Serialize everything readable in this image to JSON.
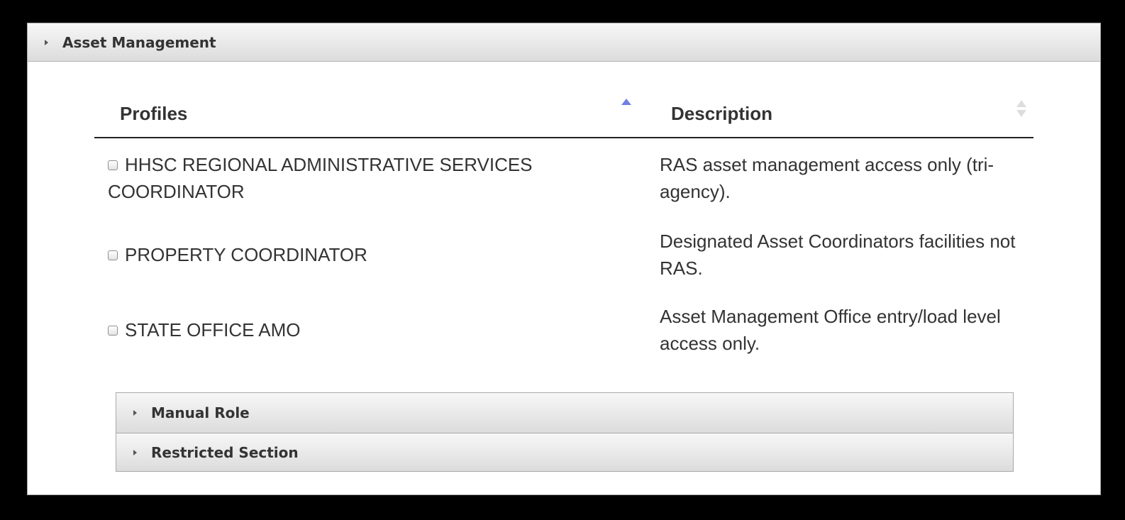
{
  "panel": {
    "title": "Asset Management"
  },
  "table": {
    "columns": {
      "profiles": "Profiles",
      "description": "Description"
    },
    "rows": [
      {
        "profile": "HHSC REGIONAL ADMINISTRATIVE SERVICES COORDINATOR",
        "description": "RAS asset management access only (tri-agency).",
        "checked": false
      },
      {
        "profile": "PROPERTY COORDINATOR",
        "description": "Designated Asset Coordinators facilities not RAS.",
        "checked": false
      },
      {
        "profile": "STATE OFFICE AMO",
        "description": "Asset Management Office entry/load level access only.",
        "checked": false
      }
    ]
  },
  "sections": {
    "manual_role": "Manual Role",
    "restricted_section": "Restricted Section"
  }
}
